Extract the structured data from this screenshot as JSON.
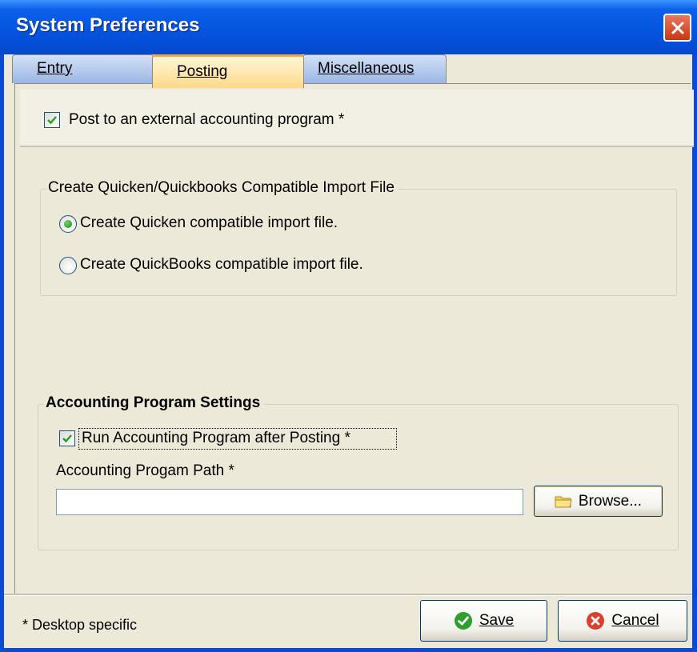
{
  "window": {
    "title": "System Preferences",
    "accent_color": "#0A4AD8",
    "close_icon": "close-icon"
  },
  "tabs": [
    {
      "label": "Entry",
      "selected": false
    },
    {
      "label": "Posting",
      "selected": true
    },
    {
      "label": "Miscellaneous",
      "selected": false
    }
  ],
  "posting": {
    "post_external_label": "Post to an external accounting program *",
    "post_external_checked": true,
    "import_group": {
      "title": "Create Quicken/Quickbooks Compatible Import File",
      "options": [
        {
          "label": "Create Quicken compatible import file.",
          "selected": true
        },
        {
          "label": "Create QuickBooks compatible import file.",
          "selected": false
        }
      ]
    },
    "settings_group": {
      "title": "Accounting Program Settings",
      "run_after_label": "Run Accounting Program after Posting  *",
      "run_after_checked": true,
      "path_label": "Accounting  Progam Path  *",
      "path_value": "",
      "browse_label": "Browse..."
    }
  },
  "footer": {
    "note": "* Desktop specific",
    "save_label": "Save",
    "cancel_label": "Cancel"
  }
}
